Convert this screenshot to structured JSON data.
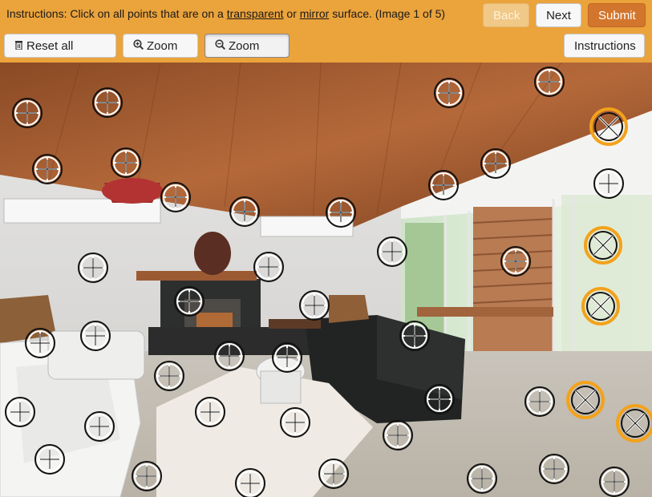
{
  "toolbar": {
    "instruction_prefix": "Instructions: Click on all points that are on a ",
    "instruction_word1": "transparent",
    "instruction_mid": " or ",
    "instruction_word2": "mirror",
    "instruction_suffix": " surface. (Image 1 of 5)",
    "back_label": "Back",
    "next_label": "Next",
    "submit_label": "Submit",
    "reset_label": "Reset all points",
    "zoom_in_label": "Zoom in",
    "zoom_out_label": "Zoom out",
    "instructions_label": "Instructions"
  },
  "icons": {
    "reset": "trash-icon",
    "zoom_in": "zoom-in-icon",
    "zoom_out": "zoom-out-icon"
  },
  "colors": {
    "toolbar_bg": "#eba33b",
    "selected_ring": "#f3a21a",
    "submit_bg": "#d3762d"
  },
  "points_total": 50,
  "points_selected": 6
}
